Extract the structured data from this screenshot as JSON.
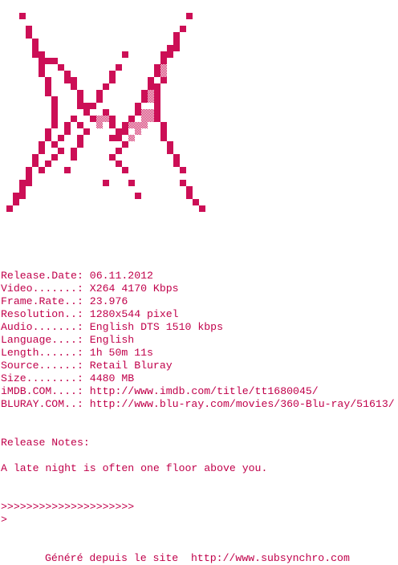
{
  "colors": {
    "accent": "#cc0f56",
    "text": "#c0004a",
    "background": "#ffffff"
  },
  "logo": {
    "description_icon": "pixel-art-x-logo-icon"
  },
  "info": [
    {
      "label": "Release.Date: ",
      "value": "06.11.2012"
    },
    {
      "label": "Video.......: ",
      "value": "X264 4170 Kbps"
    },
    {
      "label": "Frame.Rate..: ",
      "value": "23.976"
    },
    {
      "label": "Resolution..: ",
      "value": "1280x544 pixel"
    },
    {
      "label": "Audio.......: ",
      "value": "English DTS 1510 kbps"
    },
    {
      "label": "Language....: ",
      "value": "English"
    },
    {
      "label": "Length......: ",
      "value": "1h 50m 11s"
    },
    {
      "label": "Source......: ",
      "value": "Retail Bluray"
    },
    {
      "label": "Size........: ",
      "value": "4480 MB"
    },
    {
      "label": "iMDB.COM....: ",
      "value": "http://www.imdb.com/title/tt1680045/"
    },
    {
      "label": "BLURAY.COM..: ",
      "value": "http://www.blu-ray.com/movies/360-Blu-ray/51613/"
    }
  ],
  "notes": {
    "heading": "Release Notes:",
    "text": "A late night is often one floor above you."
  },
  "arrows": {
    "line1": ">>>>>>>>>>>>>>>>>>>>>",
    "line2": ">"
  },
  "footer": {
    "text": "Généré depuis le site  http://www.subsynchro.com"
  }
}
